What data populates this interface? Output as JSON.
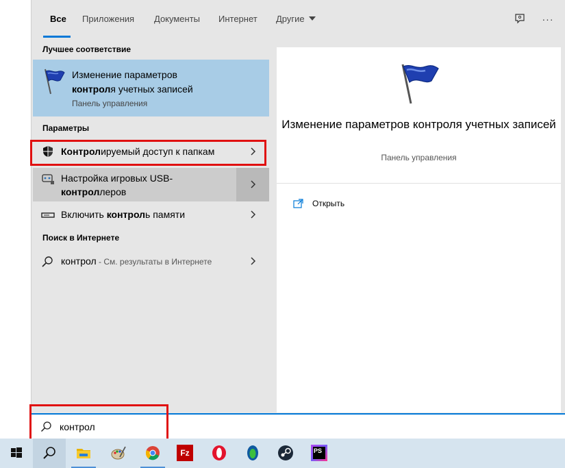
{
  "tabs": {
    "all": "Все",
    "apps": "Приложения",
    "docs": "Документы",
    "web": "Интернет",
    "other": "Другие"
  },
  "top_icons": [
    "feedback-icon",
    "more-icon"
  ],
  "more_glyph": "···",
  "sections": {
    "best_match": "Лучшее соответствие",
    "settings": "Параметры",
    "web_search": "Поиск в Интернете"
  },
  "best_match": {
    "title_line1": "Изменение параметров",
    "title_bold": "контрол",
    "title_rest": "я учетных записей",
    "subtitle": "Панель управления"
  },
  "settings_items": [
    {
      "bold": "Контрол",
      "rest": "ируемый доступ к папкам",
      "icon": "shield-icon"
    },
    {
      "line1": "Настройка игровых USB-",
      "bold": "контрол",
      "rest": "леров",
      "icon": "usb-gamepad-icon"
    },
    {
      "pre": "Включить ",
      "bold": "контрол",
      "rest": "ь памяти",
      "icon": "memory-icon"
    }
  ],
  "web_item": {
    "bold": "контрол",
    "rest": " - См. результаты в Интернете",
    "icon": "search-icon"
  },
  "preview": {
    "title": "Изменение параметров контроля учетных записей",
    "subtitle": "Панель управления",
    "open_label": "Открыть"
  },
  "search": {
    "value": "контрол"
  },
  "taskbar": {
    "items": [
      "start-icon",
      "search-icon",
      "file-explorer-icon",
      "paint-icon",
      "chrome-icon",
      "filezilla-icon",
      "opera-icon",
      "app-icon",
      "steam-icon",
      "phpstorm-icon"
    ],
    "filezilla_glyph": "Fz",
    "phpstorm_glyph": "PS"
  },
  "colors": {
    "accent": "#0078d7",
    "highlight": "#a8cce6",
    "callout": "#e01010",
    "taskbar": "#d6e4ef"
  }
}
